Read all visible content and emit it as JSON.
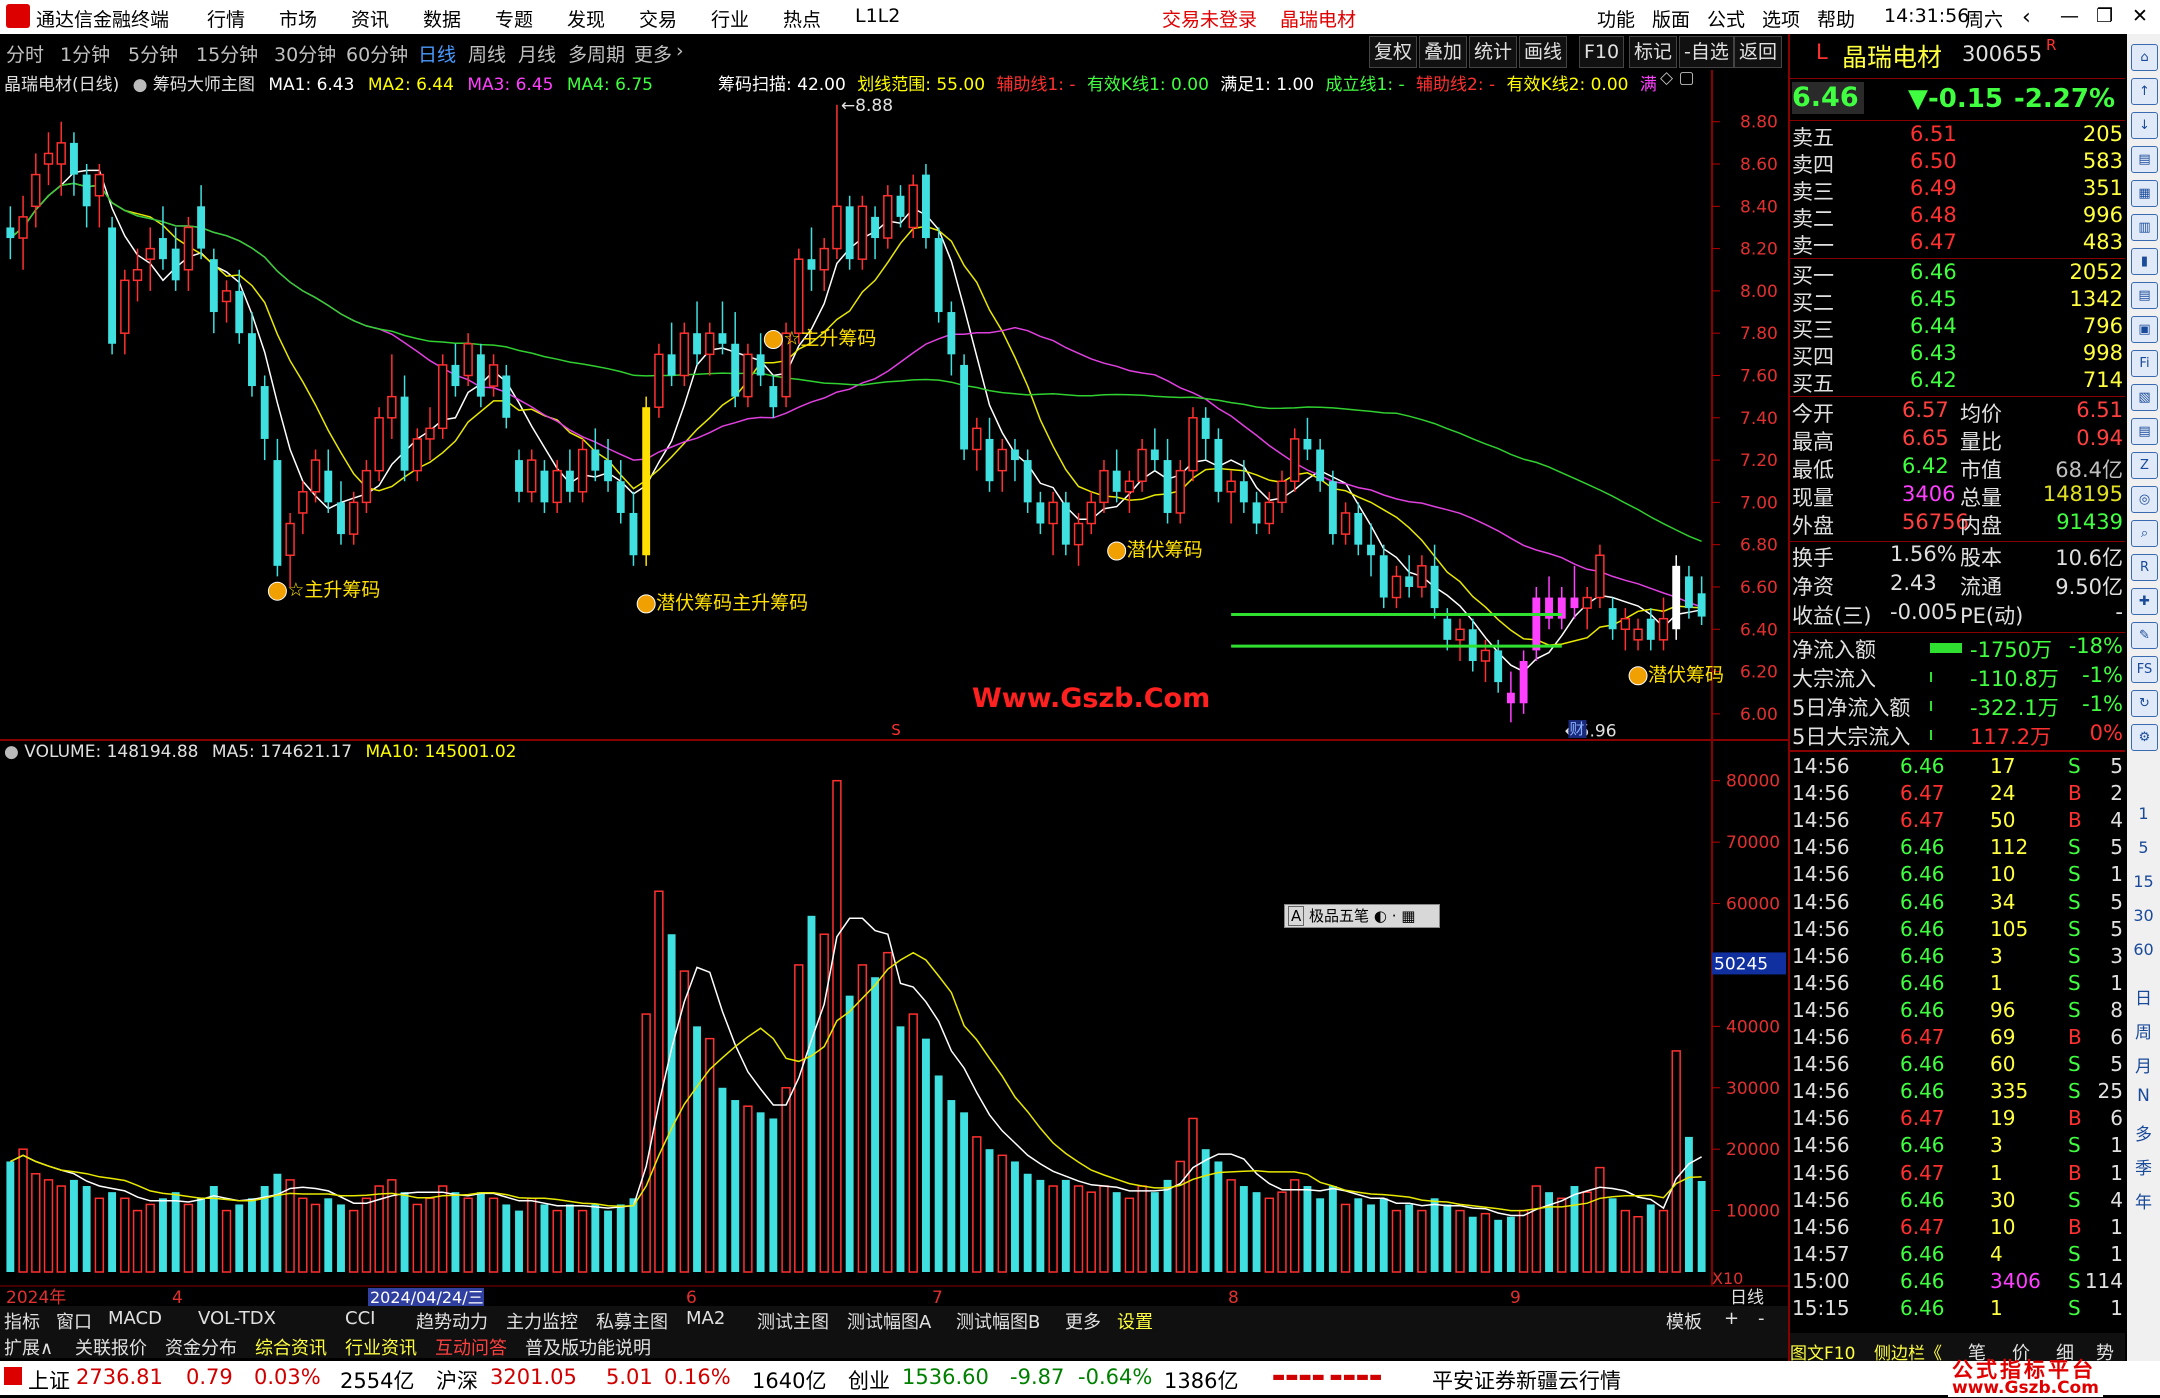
{
  "app": {
    "title": "通达信金融终端",
    "login_status": "交易未登录",
    "stock_tag": "晶瑞电材",
    "menu": [
      "行情",
      "市场",
      "资讯",
      "数据",
      "专题",
      "发现",
      "交易",
      "行业",
      "热点",
      "L1L2"
    ],
    "right_menu": [
      "功能",
      "版面",
      "公式",
      "选项",
      "帮助"
    ],
    "time": "14:31:56",
    "weekday": "周六"
  },
  "period_tabs": [
    "分时",
    "1分钟",
    "5分钟",
    "15分钟",
    "30分钟",
    "60分钟",
    "日线",
    "周线",
    "月线",
    "多周期",
    "更多"
  ],
  "active_period": "日线",
  "tool_buttons": [
    "复权",
    "叠加",
    "统计",
    "画线",
    "F10",
    "标记",
    "-自选",
    "返回"
  ],
  "main_legend": {
    "name": "晶瑞电材(日线)",
    "indicator": "筹码大师主图",
    "ma1": "MA1: 6.43",
    "ma2": "MA2: 6.44",
    "ma3": "MA3: 6.45",
    "ma4": "MA4: 6.75",
    "scan": "筹码扫描: 42.00",
    "range": "划线范围: 55.00",
    "aux1": "辅助线1: -",
    "valid1": "有效K线1: 0.00",
    "satisfy": "满足1: 1.00",
    "confirm": "成立线1: -",
    "aux2": "辅助线2: -",
    "valid2": "有效K线2: 0.00",
    "more": "满"
  },
  "vol_legend": {
    "vol": "VOLUME: 148194.88",
    "ma5": "MA5: 174621.17",
    "ma10": "MA10: 145001.02"
  },
  "price_axis": [
    "8.80",
    "8.60",
    "8.40",
    "8.20",
    "8.00",
    "7.80",
    "7.60",
    "7.40",
    "7.20",
    "7.00",
    "6.80",
    "6.60",
    "6.40",
    "6.20",
    "6.00"
  ],
  "vol_axis": [
    "80000",
    "70000",
    "60000",
    "50000",
    "40000",
    "30000",
    "20000",
    "10000"
  ],
  "vol_axis_highlight": "50245",
  "vol_multiplier": "X10",
  "high_label": "8.88",
  "low_label": "5.96",
  "watermark": "Www.Gszb.Com",
  "signals": {
    "main_up": "主升筹码",
    "lurk": "潜伏筹码",
    "cai": "财",
    "s_mark": "S"
  },
  "date_axis": [
    "2024年",
    "4",
    "2024/04/24/三",
    "6",
    "7",
    "8",
    "9"
  ],
  "date_axis_right": "日线",
  "input_widget": "极品五笔",
  "bottom_tabs": [
    "指标",
    "窗口",
    "MACD",
    "VOL-TDX",
    "CCI",
    "趋势动力",
    "主力监控",
    "私募主图",
    "MA2",
    "测试主图",
    "测试幅图A",
    "测试幅图B",
    "更多",
    "设置"
  ],
  "bottom_right": [
    "模板",
    "+",
    "-"
  ],
  "bottom_tabs2": [
    "扩展∧",
    "关联报价",
    "资金分布",
    "综合资讯",
    "行业资讯",
    "互动问答",
    "普及版功能说明"
  ],
  "bottom_tabs2_right": [
    "图文F10",
    "侧边栏《",
    "笔",
    "价",
    "细",
    "势"
  ],
  "quote": {
    "symbol_prefix": "L",
    "name": "晶瑞电材",
    "code": "300655",
    "flag": "R",
    "price": "6.46",
    "change": "▼-0.15",
    "pct": "-2.27%",
    "asks": [
      {
        "label": "卖五",
        "price": "6.51",
        "vol": "205"
      },
      {
        "label": "卖四",
        "price": "6.50",
        "vol": "583"
      },
      {
        "label": "卖三",
        "price": "6.49",
        "vol": "351"
      },
      {
        "label": "卖二",
        "price": "6.48",
        "vol": "996"
      },
      {
        "label": "卖一",
        "price": "6.47",
        "vol": "483"
      }
    ],
    "bids": [
      {
        "label": "买一",
        "price": "6.46",
        "vol": "2052"
      },
      {
        "label": "买二",
        "price": "6.45",
        "vol": "1342"
      },
      {
        "label": "买三",
        "price": "6.44",
        "vol": "796"
      },
      {
        "label": "买四",
        "price": "6.43",
        "vol": "998"
      },
      {
        "label": "买五",
        "price": "6.42",
        "vol": "714"
      }
    ],
    "stats": [
      {
        "l1": "今开",
        "v1": "6.57",
        "c1": "#ff4040",
        "l2": "均价",
        "v2": "6.51",
        "c2": "#ff4040"
      },
      {
        "l1": "最高",
        "v1": "6.65",
        "c1": "#ff4040",
        "l2": "量比",
        "v2": "0.94",
        "c2": "#ff4040"
      },
      {
        "l1": "最低",
        "v1": "6.42",
        "c1": "#40ff40",
        "l2": "市值",
        "v2": "68.4亿",
        "c2": "#c0c0c0"
      },
      {
        "l1": "现量",
        "v1": "3406",
        "c1": "#ff40ff",
        "l2": "总量",
        "v2": "148195",
        "c2": "#e0e020"
      },
      {
        "l1": "外盘",
        "v1": "56756",
        "c1": "#ff4040",
        "l2": "内盘",
        "v2": "91439",
        "c2": "#40ff40"
      }
    ],
    "stats2": [
      {
        "l1": "换手",
        "v1": "1.56%",
        "l2": "股本",
        "v2": "10.6亿"
      },
      {
        "l1": "净资",
        "v1": "2.43",
        "l2": "流通",
        "v2": "9.50亿"
      },
      {
        "l1": "收益(三)",
        "v1": "-0.005",
        "l2": "PE(动)",
        "v2": "-"
      }
    ],
    "flows": [
      {
        "label": "净流入额",
        "value": "-1750万",
        "pct": "-18%",
        "bar": 0.8
      },
      {
        "label": "大宗流入",
        "value": "-110.8万",
        "pct": "-1%",
        "bar": 0.05
      },
      {
        "label": "5日净流入额",
        "value": "-322.1万",
        "pct": "-1%",
        "bar": 0.05
      },
      {
        "label": "5日大宗流入",
        "value": "117.2万",
        "pct": "0%",
        "bar": 0.03
      }
    ],
    "ticks": [
      {
        "t": "14:56",
        "p": "6.46",
        "v": "17",
        "s": "S",
        "n": "5"
      },
      {
        "t": "14:56",
        "p": "6.47",
        "v": "24",
        "s": "B",
        "n": "2"
      },
      {
        "t": "14:56",
        "p": "6.47",
        "v": "50",
        "s": "B",
        "n": "4"
      },
      {
        "t": "14:56",
        "p": "6.46",
        "v": "112",
        "s": "S",
        "n": "5"
      },
      {
        "t": "14:56",
        "p": "6.46",
        "v": "10",
        "s": "S",
        "n": "1"
      },
      {
        "t": "14:56",
        "p": "6.46",
        "v": "34",
        "s": "S",
        "n": "5"
      },
      {
        "t": "14:56",
        "p": "6.46",
        "v": "105",
        "s": "S",
        "n": "5"
      },
      {
        "t": "14:56",
        "p": "6.46",
        "v": "3",
        "s": "S",
        "n": "3"
      },
      {
        "t": "14:56",
        "p": "6.46",
        "v": "1",
        "s": "S",
        "n": "1"
      },
      {
        "t": "14:56",
        "p": "6.46",
        "v": "96",
        "s": "S",
        "n": "8"
      },
      {
        "t": "14:56",
        "p": "6.47",
        "v": "69",
        "s": "B",
        "n": "6"
      },
      {
        "t": "14:56",
        "p": "6.46",
        "v": "60",
        "s": "S",
        "n": "5"
      },
      {
        "t": "14:56",
        "p": "6.46",
        "v": "335",
        "s": "S",
        "n": "25"
      },
      {
        "t": "14:56",
        "p": "6.47",
        "v": "19",
        "s": "B",
        "n": "6"
      },
      {
        "t": "14:56",
        "p": "6.46",
        "v": "3",
        "s": "S",
        "n": "1"
      },
      {
        "t": "14:56",
        "p": "6.47",
        "v": "1",
        "s": "B",
        "n": "1"
      },
      {
        "t": "14:56",
        "p": "6.46",
        "v": "30",
        "s": "S",
        "n": "4"
      },
      {
        "t": "14:56",
        "p": "6.47",
        "v": "10",
        "s": "B",
        "n": "1"
      },
      {
        "t": "14:57",
        "p": "6.46",
        "v": "4",
        "s": "S",
        "n": "1"
      },
      {
        "t": "15:00",
        "p": "6.46",
        "v": "3406",
        "s": "S",
        "n": "114"
      },
      {
        "t": "15:15",
        "p": "6.46",
        "v": "1",
        "s": "S",
        "n": "1"
      }
    ]
  },
  "sidebar_labels": [
    "日",
    "周",
    "月",
    "N",
    "多",
    "季",
    "年"
  ],
  "sidebar_nums": [
    "1",
    "5",
    "15",
    "30",
    "60"
  ],
  "status": {
    "sh": "上证",
    "sh_val": "2736.81",
    "sh_chg": "0.79",
    "sh_pct": "0.03%",
    "sh_amt": "2554亿",
    "sz": "沪深",
    "sz_val": "3201.05",
    "sz_chg": "5.01",
    "sz_pct": "0.16%",
    "sz_amt": "1640亿",
    "cy": "创业",
    "cy_val": "1536.60",
    "cy_chg": "-9.87",
    "cy_pct": "-0.64%",
    "cy_amt": "1386亿",
    "broker": "平安证券新疆云行情",
    "site": "公式指标平台",
    "site_url": "www.Gszb.Com"
  },
  "chart_data": {
    "type": "candlestick",
    "price_range": [
      5.9,
      8.95
    ],
    "vol_range": [
      0,
      85000
    ],
    "candles": [
      [
        8.3,
        8.4,
        8.15,
        8.25,
        18000
      ],
      [
        8.25,
        8.45,
        8.1,
        8.35,
        20000
      ],
      [
        8.4,
        8.65,
        8.3,
        8.55,
        16000
      ],
      [
        8.6,
        8.75,
        8.5,
        8.65,
        15000
      ],
      [
        8.6,
        8.8,
        8.45,
        8.7,
        14000
      ],
      [
        8.7,
        8.75,
        8.45,
        8.55,
        15000
      ],
      [
        8.55,
        8.6,
        8.3,
        8.4,
        14000
      ],
      [
        8.45,
        8.6,
        8.3,
        8.55,
        12000
      ],
      [
        8.3,
        8.35,
        7.7,
        7.75,
        13000
      ],
      [
        7.8,
        8.1,
        7.7,
        8.05,
        12000
      ],
      [
        8.05,
        8.2,
        7.95,
        8.1,
        10000
      ],
      [
        8.15,
        8.3,
        8.0,
        8.2,
        11000
      ],
      [
        8.25,
        8.4,
        8.1,
        8.15,
        12000
      ],
      [
        8.2,
        8.3,
        8.0,
        8.05,
        13000
      ],
      [
        8.1,
        8.35,
        8.0,
        8.3,
        11000
      ],
      [
        8.4,
        8.5,
        8.15,
        8.2,
        12000
      ],
      [
        8.15,
        8.2,
        7.8,
        7.9,
        14000
      ],
      [
        7.95,
        8.05,
        7.85,
        8.0,
        10000
      ],
      [
        8.0,
        8.1,
        7.75,
        7.8,
        11000
      ],
      [
        7.8,
        7.9,
        7.5,
        7.55,
        12000
      ],
      [
        7.55,
        7.6,
        7.2,
        7.3,
        14000
      ],
      [
        7.2,
        7.3,
        6.65,
        6.7,
        16000
      ],
      [
        6.75,
        6.95,
        6.6,
        6.9,
        15000
      ],
      [
        6.95,
        7.1,
        6.85,
        7.05,
        12000
      ],
      [
        7.05,
        7.25,
        7.0,
        7.2,
        11000
      ],
      [
        7.15,
        7.25,
        6.95,
        7.0,
        12000
      ],
      [
        7.0,
        7.1,
        6.8,
        6.85,
        11000
      ],
      [
        6.85,
        7.05,
        6.8,
        7.0,
        10000
      ],
      [
        7.0,
        7.2,
        6.95,
        7.15,
        12000
      ],
      [
        7.15,
        7.45,
        7.1,
        7.4,
        14000
      ],
      [
        7.4,
        7.7,
        7.3,
        7.5,
        15000
      ],
      [
        7.5,
        7.6,
        7.1,
        7.15,
        13000
      ],
      [
        7.15,
        7.35,
        7.1,
        7.3,
        11000
      ],
      [
        7.3,
        7.45,
        7.2,
        7.35,
        12000
      ],
      [
        7.35,
        7.7,
        7.3,
        7.65,
        14000
      ],
      [
        7.65,
        7.75,
        7.5,
        7.55,
        13000
      ],
      [
        7.6,
        7.8,
        7.55,
        7.75,
        12000
      ],
      [
        7.7,
        7.75,
        7.45,
        7.5,
        13000
      ],
      [
        7.55,
        7.7,
        7.5,
        7.65,
        12000
      ],
      [
        7.6,
        7.65,
        7.35,
        7.4,
        11000
      ],
      [
        7.2,
        7.25,
        7.0,
        7.05,
        10000
      ],
      [
        7.05,
        7.25,
        7.0,
        7.2,
        12000
      ],
      [
        7.15,
        7.2,
        6.95,
        7.0,
        11000
      ],
      [
        7.0,
        7.2,
        6.95,
        7.15,
        10000
      ],
      [
        7.15,
        7.25,
        7.0,
        7.05,
        11000
      ],
      [
        7.05,
        7.3,
        7.0,
        7.25,
        10000
      ],
      [
        7.25,
        7.35,
        7.1,
        7.15,
        11000
      ],
      [
        7.2,
        7.3,
        7.05,
        7.1,
        10000
      ],
      [
        7.1,
        7.2,
        6.9,
        6.95,
        11000
      ],
      [
        6.95,
        7.05,
        6.7,
        6.75,
        12000
      ],
      [
        6.75,
        7.5,
        6.7,
        7.45,
        42000
      ],
      [
        7.45,
        7.75,
        7.4,
        7.7,
        62000
      ],
      [
        7.7,
        7.85,
        7.55,
        7.6,
        55000
      ],
      [
        7.6,
        7.85,
        7.55,
        7.8,
        49000
      ],
      [
        7.8,
        7.95,
        7.65,
        7.7,
        40000
      ],
      [
        7.7,
        7.85,
        7.6,
        7.8,
        38000
      ],
      [
        7.8,
        7.95,
        7.7,
        7.75,
        30000
      ],
      [
        7.75,
        7.9,
        7.45,
        7.5,
        28000
      ],
      [
        7.5,
        7.75,
        7.45,
        7.7,
        27000
      ],
      [
        7.7,
        7.8,
        7.55,
        7.6,
        26000
      ],
      [
        7.55,
        7.6,
        7.4,
        7.45,
        25000
      ],
      [
        7.5,
        7.85,
        7.45,
        7.8,
        30000
      ],
      [
        7.8,
        8.2,
        7.75,
        8.15,
        50000
      ],
      [
        8.15,
        8.3,
        8.0,
        8.1,
        58000
      ],
      [
        8.1,
        8.25,
        8.0,
        8.2,
        55000
      ],
      [
        8.2,
        8.88,
        8.15,
        8.4,
        80000
      ],
      [
        8.4,
        8.45,
        8.1,
        8.15,
        45000
      ],
      [
        8.15,
        8.45,
        8.1,
        8.4,
        50000
      ],
      [
        8.35,
        8.4,
        8.15,
        8.25,
        48000
      ],
      [
        8.25,
        8.5,
        8.2,
        8.45,
        52000
      ],
      [
        8.45,
        8.5,
        8.3,
        8.35,
        40000
      ],
      [
        8.3,
        8.55,
        8.25,
        8.5,
        42000
      ],
      [
        8.55,
        8.6,
        8.2,
        8.25,
        38000
      ],
      [
        8.25,
        8.3,
        7.85,
        7.9,
        32000
      ],
      [
        7.9,
        7.95,
        7.6,
        7.7,
        28000
      ],
      [
        7.65,
        7.7,
        7.2,
        7.25,
        26000
      ],
      [
        7.25,
        7.4,
        7.15,
        7.35,
        22000
      ],
      [
        7.3,
        7.4,
        7.05,
        7.1,
        20000
      ],
      [
        7.15,
        7.3,
        7.05,
        7.25,
        19000
      ],
      [
        7.25,
        7.3,
        7.1,
        7.2,
        18000
      ],
      [
        7.2,
        7.25,
        6.95,
        7.0,
        16000
      ],
      [
        7.0,
        7.05,
        6.85,
        6.9,
        15000
      ],
      [
        6.9,
        7.05,
        6.75,
        7.0,
        14000
      ],
      [
        7.0,
        7.05,
        6.75,
        6.8,
        15000
      ],
      [
        6.8,
        6.95,
        6.7,
        6.9,
        14000
      ],
      [
        6.9,
        7.05,
        6.85,
        7.0,
        13000
      ],
      [
        7.0,
        7.2,
        6.95,
        7.15,
        14000
      ],
      [
        7.15,
        7.25,
        7.0,
        7.05,
        13000
      ],
      [
        7.05,
        7.15,
        6.95,
        7.1,
        12000
      ],
      [
        7.1,
        7.3,
        7.05,
        7.25,
        14000
      ],
      [
        7.25,
        7.35,
        7.15,
        7.2,
        13000
      ],
      [
        7.2,
        7.3,
        6.9,
        6.95,
        15000
      ],
      [
        6.95,
        7.2,
        6.9,
        7.15,
        18000
      ],
      [
        7.15,
        7.45,
        7.1,
        7.4,
        25000
      ],
      [
        7.4,
        7.45,
        7.2,
        7.3,
        20000
      ],
      [
        7.3,
        7.35,
        7.0,
        7.05,
        18000
      ],
      [
        7.05,
        7.15,
        6.9,
        7.1,
        15000
      ],
      [
        7.1,
        7.2,
        6.95,
        7.0,
        14000
      ],
      [
        7.0,
        7.05,
        6.85,
        6.9,
        13000
      ],
      [
        6.9,
        7.05,
        6.85,
        7.0,
        12000
      ],
      [
        7.0,
        7.15,
        6.95,
        7.1,
        13000
      ],
      [
        7.1,
        7.35,
        7.05,
        7.3,
        15000
      ],
      [
        7.3,
        7.4,
        7.2,
        7.25,
        14000
      ],
      [
        7.25,
        7.3,
        7.05,
        7.1,
        12000
      ],
      [
        7.1,
        7.15,
        6.8,
        6.85,
        14000
      ],
      [
        6.85,
        7.0,
        6.8,
        6.95,
        11000
      ],
      [
        6.95,
        7.0,
        6.75,
        6.8,
        12000
      ],
      [
        6.8,
        6.9,
        6.65,
        6.75,
        11000
      ],
      [
        6.75,
        6.8,
        6.5,
        6.55,
        12000
      ],
      [
        6.55,
        6.7,
        6.5,
        6.65,
        10000
      ],
      [
        6.65,
        6.75,
        6.55,
        6.6,
        11000
      ],
      [
        6.6,
        6.75,
        6.55,
        6.7,
        10000
      ],
      [
        6.7,
        6.8,
        6.45,
        6.5,
        12000
      ],
      [
        6.45,
        6.5,
        6.3,
        6.35,
        11000
      ],
      [
        6.35,
        6.45,
        6.25,
        6.4,
        10000
      ],
      [
        6.4,
        6.45,
        6.2,
        6.25,
        9000
      ],
      [
        6.25,
        6.35,
        6.15,
        6.3,
        9500
      ],
      [
        6.3,
        6.35,
        6.1,
        6.15,
        8500
      ],
      [
        6.1,
        6.2,
        5.96,
        6.05,
        9000
      ],
      [
        6.05,
        6.3,
        6.0,
        6.25,
        10000
      ],
      [
        6.3,
        6.6,
        6.25,
        6.55,
        14000
      ],
      [
        6.55,
        6.65,
        6.4,
        6.45,
        13000
      ],
      [
        6.45,
        6.6,
        6.4,
        6.55,
        12000
      ],
      [
        6.55,
        6.7,
        6.45,
        6.5,
        14000
      ],
      [
        6.5,
        6.6,
        6.4,
        6.55,
        13000
      ],
      [
        6.55,
        6.8,
        6.5,
        6.75,
        17000
      ],
      [
        6.5,
        6.55,
        6.35,
        6.4,
        12000
      ],
      [
        6.4,
        6.5,
        6.3,
        6.45,
        10000
      ],
      [
        6.35,
        6.45,
        6.3,
        6.4,
        9000
      ],
      [
        6.45,
        6.5,
        6.3,
        6.35,
        11000
      ],
      [
        6.35,
        6.55,
        6.3,
        6.45,
        10000
      ],
      [
        6.4,
        6.75,
        6.35,
        6.7,
        36000
      ],
      [
        6.65,
        6.7,
        6.45,
        6.5,
        22000
      ],
      [
        6.57,
        6.65,
        6.42,
        6.46,
        14819
      ]
    ]
  }
}
